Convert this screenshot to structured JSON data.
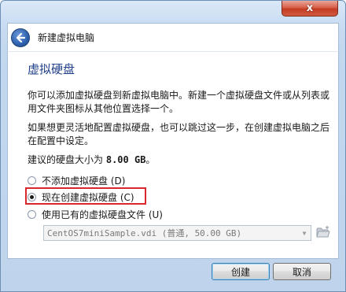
{
  "window": {
    "close_glyph": "x"
  },
  "header": {
    "title": "新建虚拟电脑",
    "back_icon": "back-arrow-icon"
  },
  "page": {
    "title": "虚拟硬盘",
    "description_1": "你可以添加虚拟硬盘到新虚拟电脑中。新建一个虚拟硬盘文件或从列表或用文件夹图标从其他位置选择一个。",
    "description_2": "如果想更灵活地配置虚拟硬盘，也可以跳过这一步，在创建虚拟电脑之后在配置中设定。",
    "size_prefix": "建议的硬盘大小为",
    "size_value": "8.00 GB",
    "size_suffix": "。"
  },
  "options": [
    {
      "label": "不添加虚拟硬盘 (D)",
      "checked": false
    },
    {
      "label": "现在创建虚拟硬盘 (C)",
      "checked": true
    },
    {
      "label": "使用已有的虚拟硬盘文件 (U)",
      "checked": false
    }
  ],
  "existing_file": {
    "value": "CentOS7miniSample.vdi (普通, 50.00 GB)"
  },
  "buttons": {
    "create": "创建",
    "cancel": "取消"
  },
  "colors": {
    "title_blue": "#1f3f8a",
    "highlight_red": "#d8282a"
  }
}
